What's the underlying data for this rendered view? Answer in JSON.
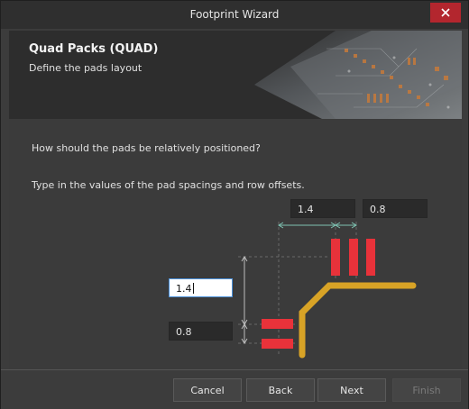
{
  "window": {
    "title": "Footprint Wizard"
  },
  "header": {
    "title": "Quad Packs (QUAD)",
    "subtitle": "Define the pads layout"
  },
  "content": {
    "question": "How should the pads be relatively positioned?",
    "instruction": "Type in the values of the pad spacings and row offsets.",
    "fields": {
      "top_left": "1.4",
      "top_right": "0.8",
      "left_upper": "1.4",
      "left_lower": "0.8"
    }
  },
  "footer": {
    "cancel": "Cancel",
    "back": "Back",
    "next": "Next",
    "finish": "Finish"
  },
  "colors": {
    "pad": "#e8323a",
    "trace": "#d8a326",
    "dimension": "#7fc3b2",
    "close": "#b3262e"
  }
}
